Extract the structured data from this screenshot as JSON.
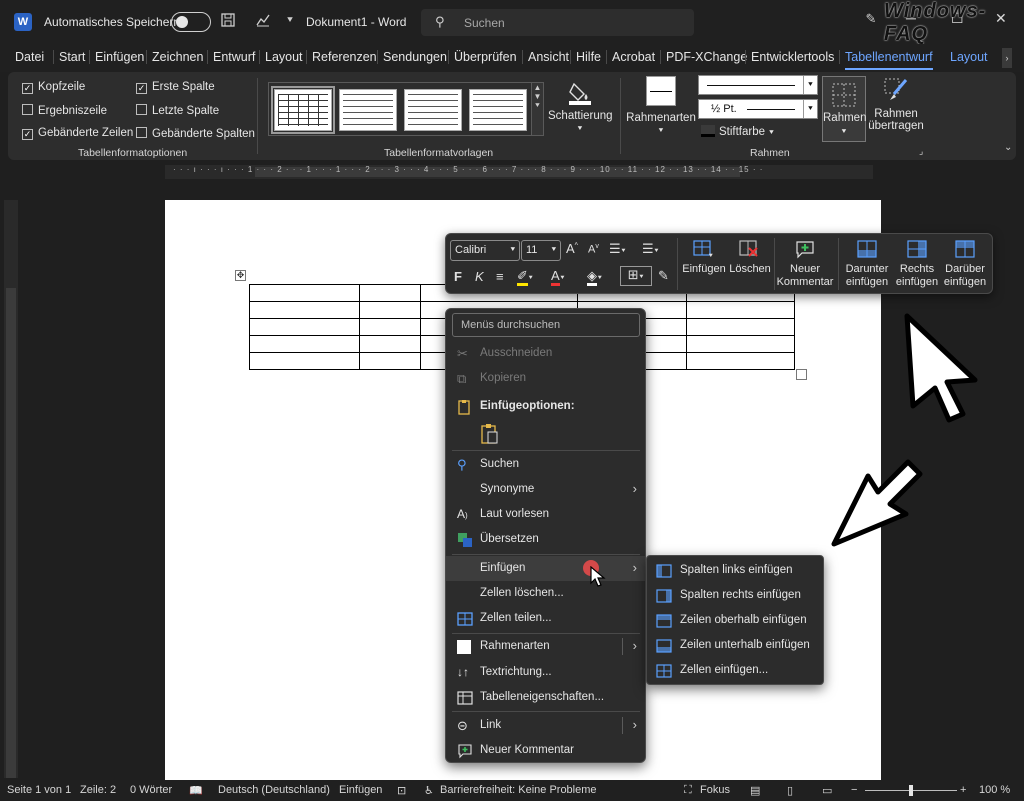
{
  "titlebar": {
    "autosave_label": "Automatisches Speichern",
    "doc_title": "Dokument1  -  Word",
    "search_placeholder": "Suchen",
    "watermark": "Windows-FAQ"
  },
  "tabs": [
    "Datei",
    "Start",
    "Einfügen",
    "Zeichnen",
    "Entwurf",
    "Layout",
    "Referenzen",
    "Sendungen",
    "Überprüfen",
    "Ansicht",
    "Hilfe",
    "Acrobat",
    "PDF-XChange",
    "Entwicklertools",
    "Tabellenentwurf",
    "Layout"
  ],
  "active_tab": "Tabellenentwurf",
  "ribbon": {
    "options": {
      "items": [
        {
          "label": "Kopfzeile",
          "checked": true
        },
        {
          "label": "Ergebniszeile",
          "checked": false
        },
        {
          "label": "Gebänderte Zeilen",
          "checked": true
        },
        {
          "label": "Erste Spalte",
          "checked": true
        },
        {
          "label": "Letzte Spalte",
          "checked": false
        },
        {
          "label": "Gebänderte Spalten",
          "checked": false
        }
      ],
      "group_label": "Tabellenformatoptionen"
    },
    "styles_group_label": "Tabellenformatvorlagen",
    "shading_label": "Schattierung",
    "borders": {
      "rahmenarten": "Rahmenarten",
      "weight": "½ Pt.",
      "pen_color": "Stiftfarbe",
      "rahmen": "Rahmen",
      "rahmen_uebertragen_1": "Rahmen",
      "rahmen_uebertragen_2": "übertragen",
      "group_label": "Rahmen"
    }
  },
  "mini_toolbar": {
    "font": "Calibri",
    "size": "11",
    "einfuegen": "Einfügen",
    "loeschen": "Löschen",
    "neuer_kommentar_1": "Neuer",
    "neuer_kommentar_2": "Kommentar",
    "darunter_1": "Darunter",
    "darunter_2": "einfügen",
    "rechts_1": "Rechts",
    "rechts_2": "einfügen",
    "darueber_1": "Darüber",
    "darueber_2": "einfügen"
  },
  "context_menu": {
    "search_placeholder": "Menüs durchsuchen",
    "items": {
      "ausschneiden": "Ausschneiden",
      "kopieren": "Kopieren",
      "einfuegeoptionen": "Einfügeoptionen:",
      "suchen": "Suchen",
      "synonyme": "Synonyme",
      "laut_vorlesen": "Laut vorlesen",
      "uebersetzen": "Übersetzen",
      "einfuegen": "Einfügen",
      "zellen_loeschen": "Zellen löschen...",
      "zellen_teilen": "Zellen teilen...",
      "rahmenarten": "Rahmenarten",
      "textrichtung": "Textrichtung...",
      "tabelleneigenschaften": "Tabelleneigenschaften...",
      "link": "Link",
      "neuer_kommentar": "Neuer Kommentar"
    }
  },
  "submenu": {
    "items": [
      "Spalten links einfügen",
      "Spalten rechts einfügen",
      "Zeilen oberhalb einfügen",
      "Zeilen unterhalb einfügen",
      "Zellen einfügen..."
    ]
  },
  "statusbar": {
    "page": "Seite 1 von 1",
    "line": "Zeile: 2",
    "words": "0 Wörter",
    "language": "Deutsch (Deutschland)",
    "mode": "Einfügen",
    "accessibility": "Barrierefreiheit: Keine Probleme",
    "focus": "Fokus",
    "zoom": "100 %"
  },
  "colors": {
    "accent": "#6ea6ff",
    "background": "#1f1f1f",
    "ribbon": "#2d2d2d",
    "menu": "#2c2c2c",
    "icon_blue": "#5aa0ff"
  }
}
